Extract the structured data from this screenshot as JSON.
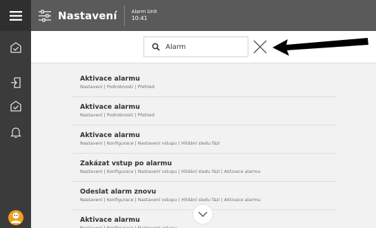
{
  "header": {
    "title": "Nastavení",
    "unit_name": "Alarm Unit",
    "time": "10:41"
  },
  "search": {
    "value": "Alarm",
    "placeholder": ""
  },
  "results": [
    {
      "name": "Aktivace alarmu",
      "path": "Nastavení | Podrobnosti | Přehled"
    },
    {
      "name": "Aktivace alarmu",
      "path": "Nastavení | Podrobnosti | Přehled"
    },
    {
      "name": "Aktivace alarmu",
      "path": "Nastavení | Konfigurace | Nastavení vstupu | Hlídání sledu fází"
    },
    {
      "name": "Zakázat vstup po alarmu",
      "path": "Nastavení | Konfigurace | Nastavení vstupu | Hlídání sledu fází | Aktivace alarmu"
    },
    {
      "name": "Odeslat alarm znovu",
      "path": "Nastavení | Konfigurace | Nastavení vstupu | Hlídání sledu fází | Aktivace alarmu"
    },
    {
      "name": "Aktivace alarmu",
      "path": "Nastavení | Konfigurace | Nastavení vstupu"
    }
  ],
  "icons": {
    "rail": [
      "menu-icon",
      "home-icon",
      "logout-icon",
      "check-house-icon",
      "bell-icon",
      "avatar"
    ],
    "header": "sliders-icon",
    "search": "search-icon",
    "clear": "close-icon",
    "annotation": "arrow-icon",
    "scroll": "chevron-down-icon"
  },
  "colors": {
    "rail": "#3b3b3b",
    "topbar": "#5a5a5a",
    "content": "#f2f2f2",
    "accent": "#f0a020"
  }
}
